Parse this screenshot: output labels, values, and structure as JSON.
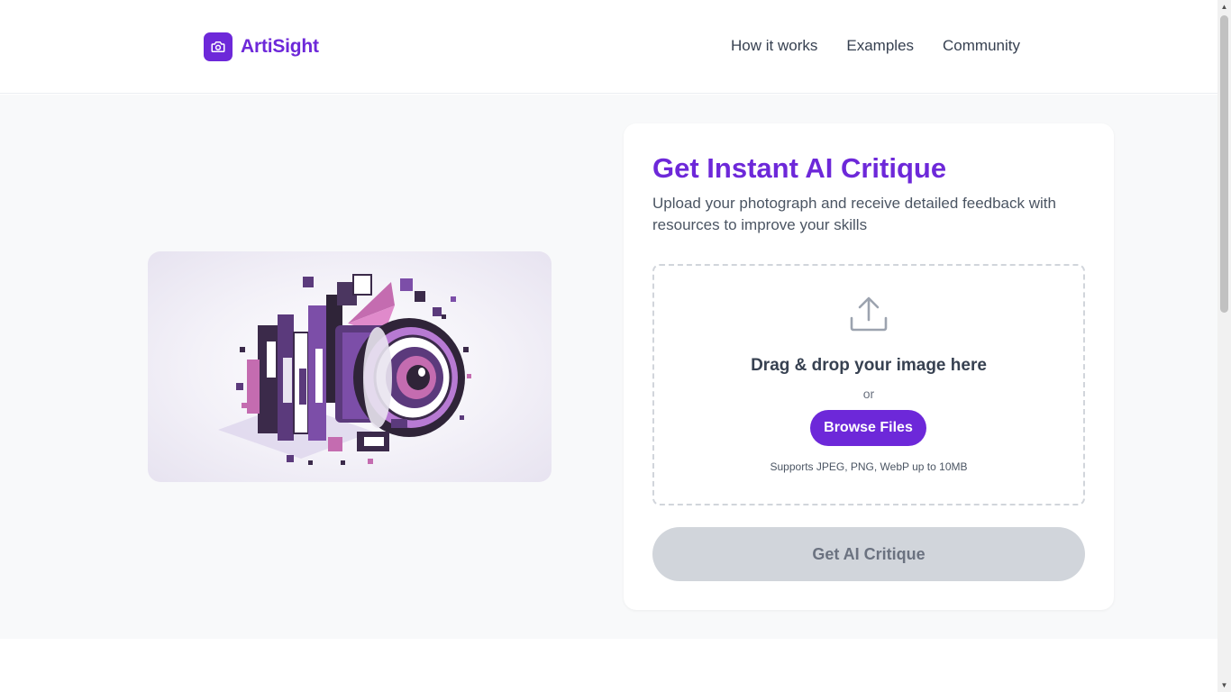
{
  "brand": {
    "name": "ArtiSight",
    "icon": "camera-icon",
    "color": "#6d28d9"
  },
  "nav": {
    "items": [
      {
        "label": "How it works"
      },
      {
        "label": "Examples"
      },
      {
        "label": "Community"
      }
    ]
  },
  "hero": {
    "image_icon": "isometric-camera-illustration"
  },
  "card": {
    "title": "Get Instant AI Critique",
    "subtitle": "Upload your photograph and receive detailed feedback with resources to improve your skills"
  },
  "upload": {
    "icon": "upload-icon",
    "title": "Drag & drop your image here",
    "or": "or",
    "browse_label": "Browse Files",
    "support": "Supports JPEG, PNG, WebP up to 10MB"
  },
  "submit": {
    "label": "Get AI Critique",
    "state": "disabled"
  },
  "colors": {
    "accent": "#6d28d9",
    "background": "#f8f9fa",
    "disabled": "#d1d5db"
  }
}
